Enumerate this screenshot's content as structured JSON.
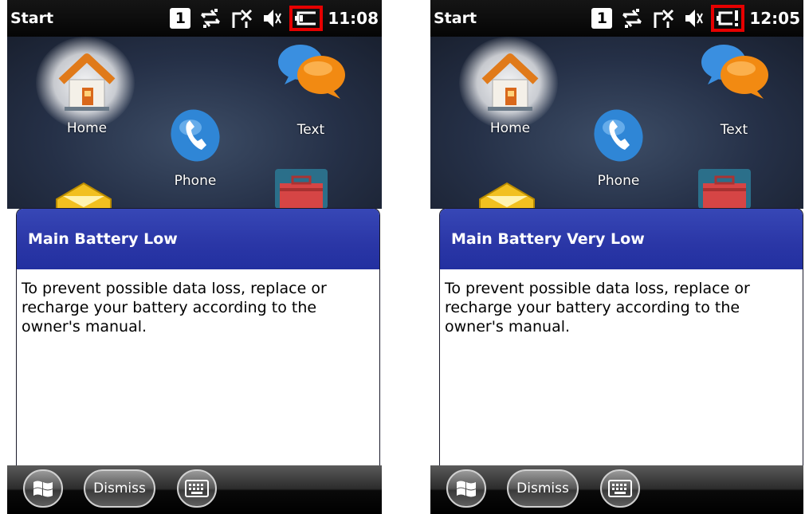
{
  "screens": [
    {
      "statusbar": {
        "title": "Start",
        "sim": "1",
        "time": "11:08",
        "battery_state": "low"
      },
      "home": {
        "tiles": {
          "home": "Home",
          "phone": "Phone",
          "text": "Text"
        }
      },
      "dialog": {
        "title": "Main Battery Low",
        "message": "To prevent possible data loss, replace or recharge your battery according to the owner's manual."
      },
      "taskbar": {
        "dismiss": "Dismiss"
      }
    },
    {
      "statusbar": {
        "title": "Start",
        "sim": "1",
        "time": "12:05",
        "battery_state": "very-low"
      },
      "home": {
        "tiles": {
          "home": "Home",
          "phone": "Phone",
          "text": "Text"
        }
      },
      "dialog": {
        "title": "Main Battery Very Low",
        "message": "To prevent possible data loss, replace or recharge your battery according to the owner's manual."
      },
      "taskbar": {
        "dismiss": "Dismiss"
      }
    }
  ],
  "colors": {
    "highlight": "#e60000",
    "dialog_header": "#2f3db0",
    "status_bar": "#0d0d0d"
  }
}
